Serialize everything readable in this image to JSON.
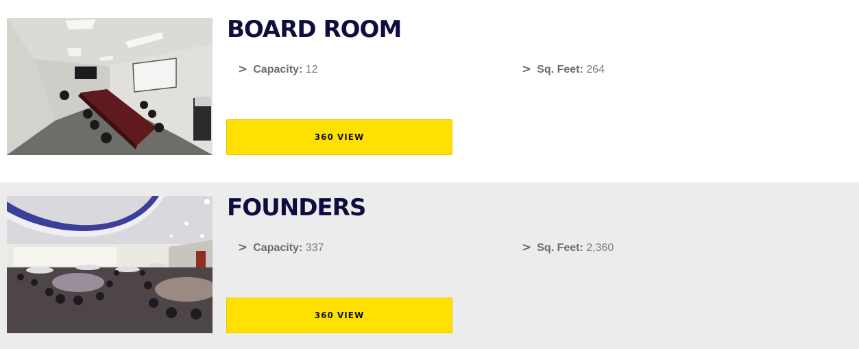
{
  "rooms": [
    {
      "name": "BOARD ROOM",
      "capacity_label": "Capacity:",
      "capacity_value": "12",
      "sqft_label": "Sq. Feet:",
      "sqft_value": "264",
      "button_label": "360 VIEW"
    },
    {
      "name": "FOUNDERS",
      "capacity_label": "Capacity:",
      "capacity_value": "337",
      "sqft_label": "Sq. Feet:",
      "sqft_value": "2,360",
      "button_label": "360 VIEW"
    }
  ],
  "icons": {
    "bullet": ">"
  },
  "colors": {
    "title": "#0d0e3f",
    "button": "#ffe000",
    "alt_row_bg": "#ececec",
    "spec_text": "#7b7b7b"
  }
}
